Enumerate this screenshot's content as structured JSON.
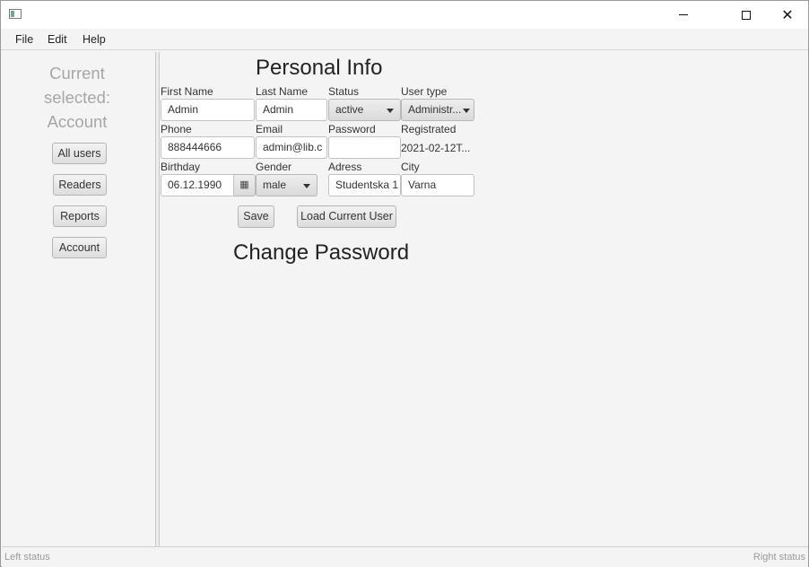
{
  "window": {
    "controls": {
      "minimize": "minimize",
      "maximize": "maximize",
      "close": "✕"
    }
  },
  "menu": {
    "items": [
      "File",
      "Edit",
      "Help"
    ]
  },
  "sidebar": {
    "current_lines": [
      "Current",
      "selected:",
      "Account"
    ],
    "buttons": [
      "All users",
      "Readers",
      "Reports",
      "Account"
    ]
  },
  "personal_info": {
    "title": "Personal Info",
    "fields": {
      "first_name": {
        "label": "First Name",
        "value": "Admin"
      },
      "last_name": {
        "label": "Last Name",
        "value": "Admin"
      },
      "status": {
        "label": "Status",
        "value": "active"
      },
      "user_type": {
        "label": "User type",
        "value": "Administr..."
      },
      "phone": {
        "label": "Phone",
        "value": "888444666"
      },
      "email": {
        "label": "Email",
        "value": "admin@lib.c"
      },
      "password": {
        "label": "Password",
        "value": ""
      },
      "registrated": {
        "label": "Registrated",
        "value": "2021-02-12T..."
      },
      "birthday": {
        "label": "Birthday",
        "value": "06.12.1990"
      },
      "gender": {
        "label": "Gender",
        "value": "male"
      },
      "adress": {
        "label": "Adress",
        "value": "Studentska 1"
      },
      "city": {
        "label": "City",
        "value": "Varna"
      }
    },
    "save_button": "Save",
    "load_button": "Load Current User"
  },
  "change_password": {
    "title": "Change Password"
  },
  "statusbar": {
    "left": "Left status",
    "right": "Right status"
  }
}
